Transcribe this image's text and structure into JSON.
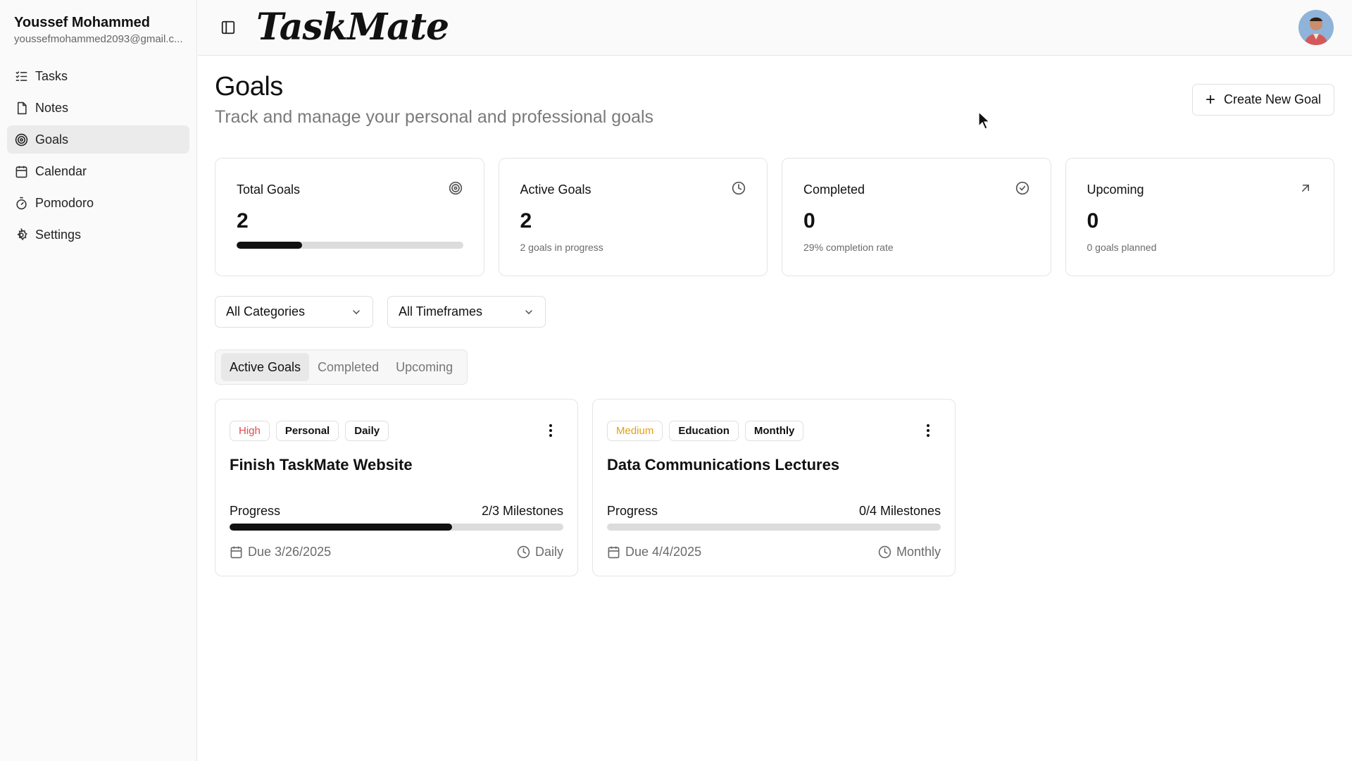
{
  "user": {
    "name": "Youssef Mohammed",
    "email": "youssefmohammed2093@gmail.c..."
  },
  "sidebar": {
    "items": [
      {
        "label": "Tasks",
        "icon": "list-checks-icon",
        "active": false
      },
      {
        "label": "Notes",
        "icon": "file-icon",
        "active": false
      },
      {
        "label": "Goals",
        "icon": "target-icon",
        "active": true
      },
      {
        "label": "Calendar",
        "icon": "calendar-icon",
        "active": false
      },
      {
        "label": "Pomodoro",
        "icon": "timer-icon",
        "active": false
      },
      {
        "label": "Settings",
        "icon": "gear-icon",
        "active": false
      }
    ]
  },
  "header": {
    "logo": "TaskMate"
  },
  "page": {
    "title": "Goals",
    "subtitle": "Track and manage your personal and professional goals",
    "create_label": "Create New Goal"
  },
  "stats": [
    {
      "label": "Total Goals",
      "value": "2",
      "icon": "target-icon",
      "progress": 0.29
    },
    {
      "label": "Active Goals",
      "value": "2",
      "sub": "2 goals in progress",
      "icon": "clock-icon"
    },
    {
      "label": "Completed",
      "value": "0",
      "sub": "29% completion rate",
      "icon": "check-circle-icon"
    },
    {
      "label": "Upcoming",
      "value": "0",
      "sub": "0 goals planned",
      "icon": "arrow-up-right-icon"
    }
  ],
  "filters": {
    "category": "All Categories",
    "timeframe": "All Timeframes"
  },
  "tabs": [
    {
      "label": "Active Goals",
      "active": true
    },
    {
      "label": "Completed",
      "active": false
    },
    {
      "label": "Upcoming",
      "active": false
    }
  ],
  "goals": [
    {
      "priority": "High",
      "priority_color": "#e5484d",
      "category": "Personal",
      "timeframe": "Daily",
      "title": "Finish TaskMate Website",
      "progress_label": "Progress",
      "milestones": "2/3 Milestones",
      "progress": 0.667,
      "due": "Due 3/26/2025",
      "frequency": "Daily"
    },
    {
      "priority": "Medium",
      "priority_color": "#e5a00d",
      "category": "Education",
      "timeframe": "Monthly",
      "title": "Data Communications Lectures",
      "progress_label": "Progress",
      "milestones": "0/4 Milestones",
      "progress": 0,
      "due": "Due 4/4/2025",
      "frequency": "Monthly"
    }
  ]
}
